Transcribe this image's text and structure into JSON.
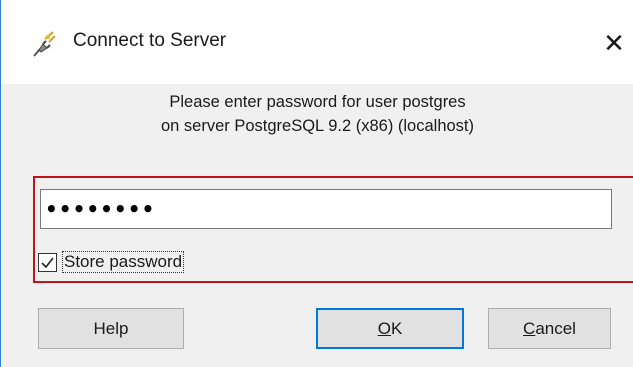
{
  "window": {
    "title": "Connect to Server",
    "close_glyph": "✕",
    "icon": "plug-icon"
  },
  "message": {
    "line1": "Please enter password for user postgres",
    "line2": "on server PostgreSQL 9.2 (x86) (localhost)"
  },
  "password": {
    "masked_value": "••••••••"
  },
  "store_password": {
    "checked": true,
    "label": "Store password"
  },
  "buttons": {
    "help_label": "Help",
    "ok_label": "OK",
    "ok_mnemonic": "O",
    "ok_rest": "K",
    "cancel_label": "Cancel",
    "cancel_mnemonic": "C",
    "cancel_rest": "ancel"
  },
  "colors": {
    "highlight": "#c0141b",
    "default_button_border": "#0078d7",
    "client_background": "#f0f0f0"
  }
}
